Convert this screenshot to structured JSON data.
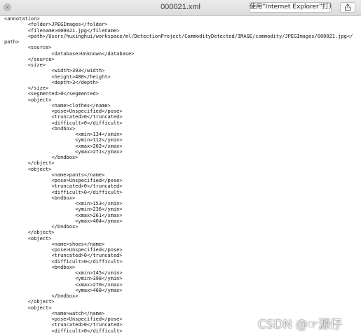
{
  "window": {
    "title": "000021.xml",
    "open_with_label": "使用“Internet Explorer”打开",
    "close_icon": "×"
  },
  "document": {
    "lines": [
      "<annotation>",
      "\t<folder>JPEGImages</folder>",
      "\t<filename>000021.jpg</filename>",
      "\t<path>/Users/huxinghui/workspace/ml/DetectionProject/CommodityDetected/IMAGE/commodity/JPEGImages/000021.jpg</path>",
      "\t<source>",
      "\t\t<database>Unknown</database>",
      "\t</source>",
      "\t<size>",
      "\t\t<width>393</width>",
      "\t\t<height>480</height>",
      "\t\t<depth>3</depth>",
      "\t</size>",
      "\t<segmented>0</segmented>",
      "\t<object>",
      "\t\t<name>clothes</name>",
      "\t\t<pose>Unspecified</pose>",
      "\t\t<truncated>0</truncated>",
      "\t\t<difficult>0</difficult>",
      "\t\t<bndbox>",
      "\t\t\t<xmin>134</xmin>",
      "\t\t\t<ymin>112</ymin>",
      "\t\t\t<xmax>262</xmax>",
      "\t\t\t<ymax>271</ymax>",
      "\t\t</bndbox>",
      "\t</object>",
      "\t<object>",
      "\t\t<name>pants</name>",
      "\t\t<pose>Unspecified</pose>",
      "\t\t<truncated>0</truncated>",
      "\t\t<difficult>0</difficult>",
      "\t\t<bndbox>",
      "\t\t\t<xmin>153</xmin>",
      "\t\t\t<ymin>236</ymin>",
      "\t\t\t<xmax>261</xmax>",
      "\t\t\t<ymax>404</ymax>",
      "\t\t</bndbox>",
      "\t</object>",
      "\t<object>",
      "\t\t<name>shoes</name>",
      "\t\t<pose>Unspecified</pose>",
      "\t\t<truncated>0</truncated>",
      "\t\t<difficult>0</difficult>",
      "\t\t<bndbox>",
      "\t\t\t<xmin>145</xmin>",
      "\t\t\t<ymin>398</ymin>",
      "\t\t\t<xmax>270</xmax>",
      "\t\t\t<ymax>468</ymax>",
      "\t\t</bndbox>",
      "\t</object>",
      "\t<object>",
      "\t\t<name>watch</name>",
      "\t\t<pose>Unspecified</pose>",
      "\t\t<truncated>0</truncated>",
      "\t\t<difficult>0</difficult>"
    ]
  },
  "watermark": "CSDN @☞源仔",
  "icons": {
    "close": "close-icon",
    "share": "share-icon"
  }
}
